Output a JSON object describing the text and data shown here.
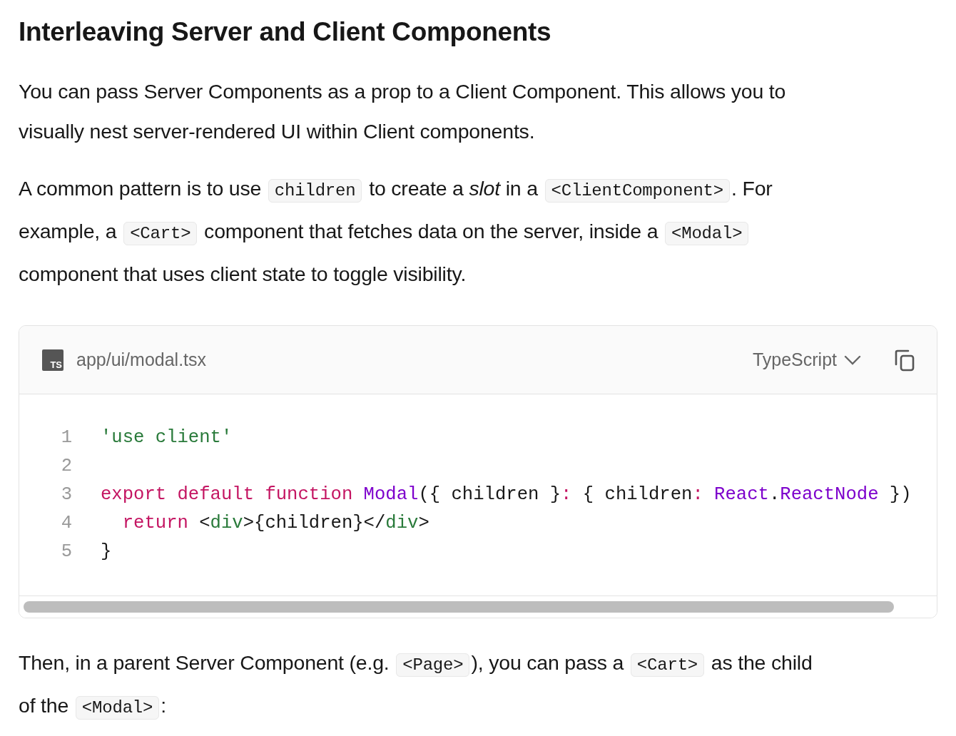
{
  "heading": "Interleaving Server and Client Components",
  "paragraphs": [
    [
      [
        {
          "kind": "text",
          "text": "You can pass Server Components as a prop to a Client Component. This allows you to"
        }
      ],
      [
        {
          "kind": "text",
          "text": "visually nest server-rendered UI within Client components."
        }
      ]
    ],
    [
      [
        {
          "kind": "text",
          "text": "A common pattern is to use"
        },
        {
          "kind": "code",
          "text": "children"
        },
        {
          "kind": "text",
          "text": "to create a *slot* in a"
        },
        {
          "kind": "code",
          "text": "<ClientComponent>"
        },
        {
          "kind": "text",
          "text": ". For"
        }
      ],
      [
        {
          "kind": "text",
          "text": "example, a"
        },
        {
          "kind": "code",
          "text": "<Cart>"
        },
        {
          "kind": "text",
          "text": "component that fetches data on the server, inside a"
        },
        {
          "kind": "code",
          "text": "<Modal>"
        }
      ],
      [
        {
          "kind": "text",
          "text": "component that uses client state to toggle visibility."
        }
      ]
    ]
  ],
  "code_block": {
    "language_badge": "TS",
    "filename": "app/ui/modal.tsx",
    "language": "TypeScript",
    "lines": [
      {
        "number": "1",
        "tokens": [
          {
            "kind": "string",
            "text": "'use client'"
          }
        ]
      },
      {
        "number": "2"
      },
      {
        "number": "3",
        "tokens": [
          {
            "kind": "keyword",
            "text": "export default function"
          },
          {
            "kind": "name",
            "text": " Modal"
          },
          {
            "kind": "plain",
            "text": "({ children }"
          },
          {
            "kind": "keyword",
            "text": ":"
          },
          {
            "kind": "plain",
            "text": " { children"
          },
          {
            "kind": "keyword",
            "text": ":"
          },
          {
            "kind": "name",
            "text": " React"
          },
          {
            "kind": "plain",
            "text": "."
          },
          {
            "kind": "name",
            "text": "ReactNode"
          },
          {
            "kind": "plain",
            "text": " })"
          }
        ]
      },
      {
        "number": "4",
        "tokens": [
          {
            "kind": "keyword",
            "text": "  return"
          },
          {
            "kind": "plain",
            "text": " <"
          },
          {
            "kind": "tag",
            "text": "div"
          },
          {
            "kind": "plain",
            "text": ">{children}</"
          },
          {
            "kind": "tag",
            "text": "div"
          },
          {
            "kind": "plain",
            "text": ">"
          }
        ]
      },
      {
        "number": "5",
        "tokens": [
          {
            "kind": "plain",
            "text": "}"
          }
        ]
      }
    ]
  },
  "after": [
    [
      [
        {
          "kind": "text",
          "text": "Then, in a parent Server Component (e.g."
        },
        {
          "kind": "code",
          "text": "<Page>"
        },
        {
          "kind": "text",
          "text": "), you can pass a"
        },
        {
          "kind": "code",
          "text": "<Cart>"
        },
        {
          "kind": "text",
          "text": "as the child"
        }
      ],
      [
        {
          "kind": "text",
          "text": "of the"
        },
        {
          "kind": "code",
          "text": "<Modal>"
        },
        {
          "kind": "text",
          "text": ":"
        }
      ]
    ]
  ]
}
